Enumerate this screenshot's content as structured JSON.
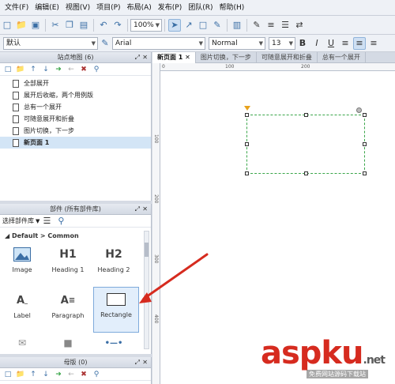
{
  "menu": [
    "文件(F)",
    "编辑(E)",
    "视图(V)",
    "项目(P)",
    "布局(A)",
    "发布(P)",
    "团队(R)",
    "帮助(H)"
  ],
  "toolbar1": {
    "zoom": "100%"
  },
  "toolbar2": {
    "style": "默认",
    "font": "Arial",
    "weight": "Normal",
    "size": "13"
  },
  "sitemap": {
    "title": "站点地图 (6)",
    "pages": [
      "全部展开",
      "展开后收缩，两个用例版",
      "总有一个展开",
      "可随意展开和折叠",
      "图片切换，下一步",
      "新页面 1"
    ],
    "selected_index": 5
  },
  "widgets": {
    "title": "部件 (所有部件库)",
    "library_select": "选择部件库",
    "group": "Default > Common",
    "items": [
      {
        "label": "Image",
        "icon": "image-icon"
      },
      {
        "label": "Heading 1",
        "icon": "H1"
      },
      {
        "label": "Heading 2",
        "icon": "H2"
      },
      {
        "label": "Label",
        "icon": "label-icon"
      },
      {
        "label": "Paragraph",
        "icon": "paragraph-icon"
      },
      {
        "label": "Rectangle",
        "icon": "rectangle-icon"
      }
    ]
  },
  "masters": {
    "title": "母版 (0)"
  },
  "editor": {
    "tabs": [
      "新页面 1",
      "图片切换，下一步",
      "可随意展开和折叠",
      "总有一个展开"
    ],
    "ruler_h": [
      "0",
      "100",
      "200"
    ],
    "ruler_v": [
      "100",
      "200",
      "300",
      "400"
    ]
  },
  "watermark": {
    "main": "aspku",
    "tld": ".net",
    "sub": "免费网站源码下载站"
  },
  "colors": {
    "selection_green": "#3aa64a",
    "arrow_red": "#d62b1f",
    "highlight_blue": "#e2eefb"
  }
}
